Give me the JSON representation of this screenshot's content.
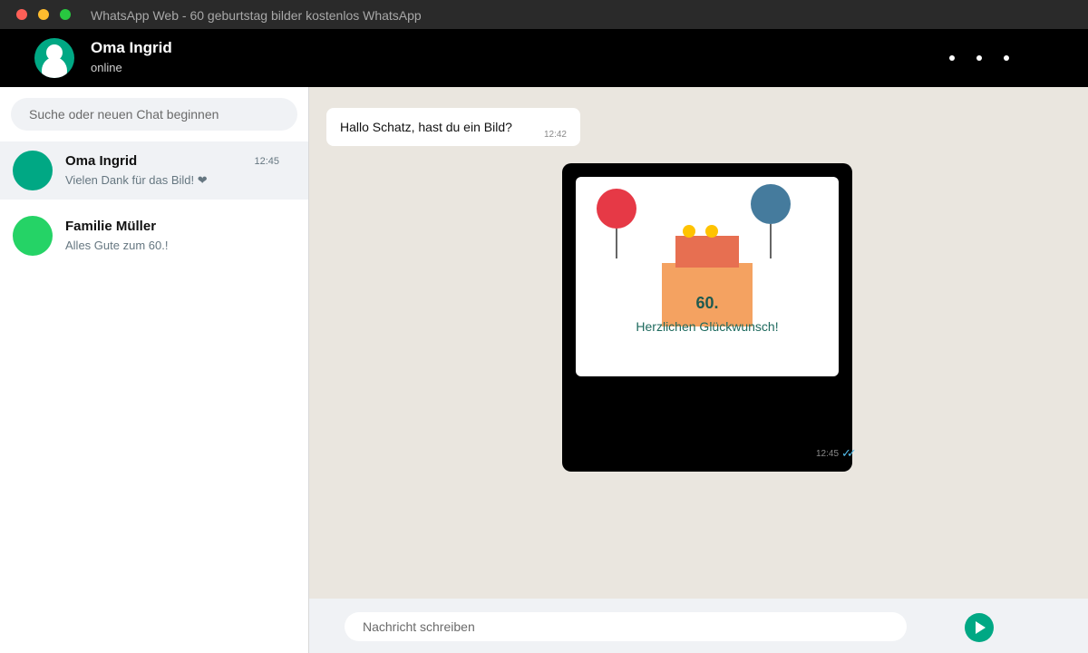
{
  "window": {
    "title": "WhatsApp Web - 60 geburtstag bilder kostenlos WhatsApp"
  },
  "header": {
    "contact_name": "Oma Ingrid",
    "status": "online",
    "menu_icon": "more-dots-icon"
  },
  "sidebar": {
    "search_placeholder": "Suche oder neuen Chat beginnen",
    "chats": [
      {
        "name": "Oma Ingrid",
        "preview": "Vielen Dank für das Bild! ❤",
        "time": "12:45",
        "active": true,
        "avatar_color": "#00a884"
      },
      {
        "name": "Familie Müller",
        "preview": "Alles Gute zum 60.!",
        "time": "",
        "active": false,
        "avatar_color": "#25d366"
      }
    ]
  },
  "conversation": {
    "incoming": {
      "text": "Hallo Schatz, hast du ein Bild?",
      "time": "12:42"
    },
    "image_message": {
      "card_age": "60.",
      "card_greeting": "Herzlichen Glückwunsch!",
      "time": "12:45",
      "ticks": "✓✓",
      "colors": {
        "balloon_left": "#e63946",
        "balloon_right": "#457b9d",
        "cake_top": "#e76f51",
        "cake_base": "#f4a261",
        "candles": "#ffc300"
      }
    }
  },
  "composer": {
    "placeholder": "Nachricht schreiben",
    "send_icon": "send-icon"
  },
  "theme": {
    "accent": "#00a884",
    "header_bg": "#000000",
    "chat_bg": "#eae6df",
    "read_ticks": "#53bdeb"
  }
}
